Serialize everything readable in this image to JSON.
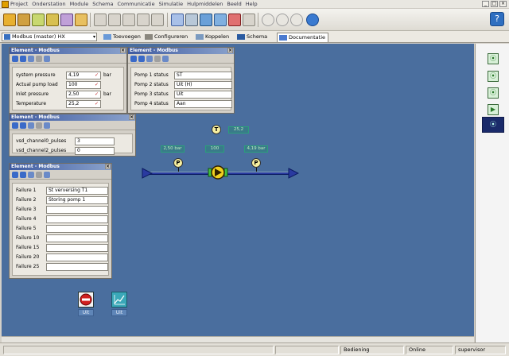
{
  "menu": {
    "items": [
      "Project",
      "Onderstation",
      "Module",
      "Schema",
      "Communicatie",
      "Simulatie",
      "Hulpmiddelen",
      "Beeld",
      "Help"
    ],
    "window_controls": [
      "_",
      "□",
      "×"
    ]
  },
  "toolbar": {
    "help_glyph": "?"
  },
  "tabbar": {
    "module_select_value": "Modbus (master) HX",
    "tabs": [
      {
        "label": "Toevoegen"
      },
      {
        "label": "Configureren"
      },
      {
        "label": "Koppelen"
      },
      {
        "label": "Schema"
      },
      {
        "label": "Documentatie"
      }
    ]
  },
  "win1": {
    "title": "Element - Modbus",
    "rows": [
      {
        "label": "system pressure",
        "value": "4,19",
        "unit": "bar"
      },
      {
        "label": "Actual pump load",
        "value": "100",
        "unit": ""
      },
      {
        "label": "Inlet pressure",
        "value": "2,50",
        "unit": "bar"
      },
      {
        "label": "Temperature",
        "value": "25,2",
        "unit": ""
      }
    ]
  },
  "win2": {
    "title": "Element - Modbus",
    "rows": [
      {
        "label": "Pomp 1 status",
        "value": "ST"
      },
      {
        "label": "Pomp 2 status",
        "value": "Uit (H)"
      },
      {
        "label": "Pomp 3 status",
        "value": "Uit"
      },
      {
        "label": "Pomp 4 status",
        "value": "Aan"
      }
    ]
  },
  "win3": {
    "title": "Element - Modbus",
    "rows": [
      {
        "label": "vsd_channel0_pulses",
        "value": "3"
      },
      {
        "label": "vsd_channel2_pulses",
        "value": "0"
      }
    ]
  },
  "win4": {
    "title": "Element - Modbus",
    "rows": [
      {
        "label": "Failure 1",
        "value": "St verversing T1"
      },
      {
        "label": "Failure 2",
        "value": "Storing pomp 1"
      },
      {
        "label": "Failure 3",
        "value": ""
      },
      {
        "label": "Failure 4",
        "value": ""
      },
      {
        "label": "Failure 5",
        "value": ""
      },
      {
        "label": "Failure 10",
        "value": ""
      },
      {
        "label": "Failure 15",
        "value": ""
      },
      {
        "label": "Failure 20",
        "value": ""
      },
      {
        "label": "Failure 25",
        "value": ""
      }
    ]
  },
  "diagram": {
    "temp_badge": "T",
    "temp_value": "25,2",
    "pressure_badge": "P",
    "inlet_value": "2,50 bar",
    "load_value": "100",
    "outlet_value": "4,19 bar"
  },
  "buttons": {
    "stop_caption": "Uit",
    "trend_caption": "Uit"
  },
  "sidepanel": {
    "buttons": [
      "⦿",
      "⦿",
      "⦿",
      "▶",
      "⦿"
    ]
  },
  "statusbar": {
    "cells": [
      "Bediening",
      "Online",
      "supervisor"
    ]
  },
  "colors": {
    "canvas": "#4a6e9e",
    "pipe": "#2a3aa0",
    "value_text": "#bff0c0"
  }
}
